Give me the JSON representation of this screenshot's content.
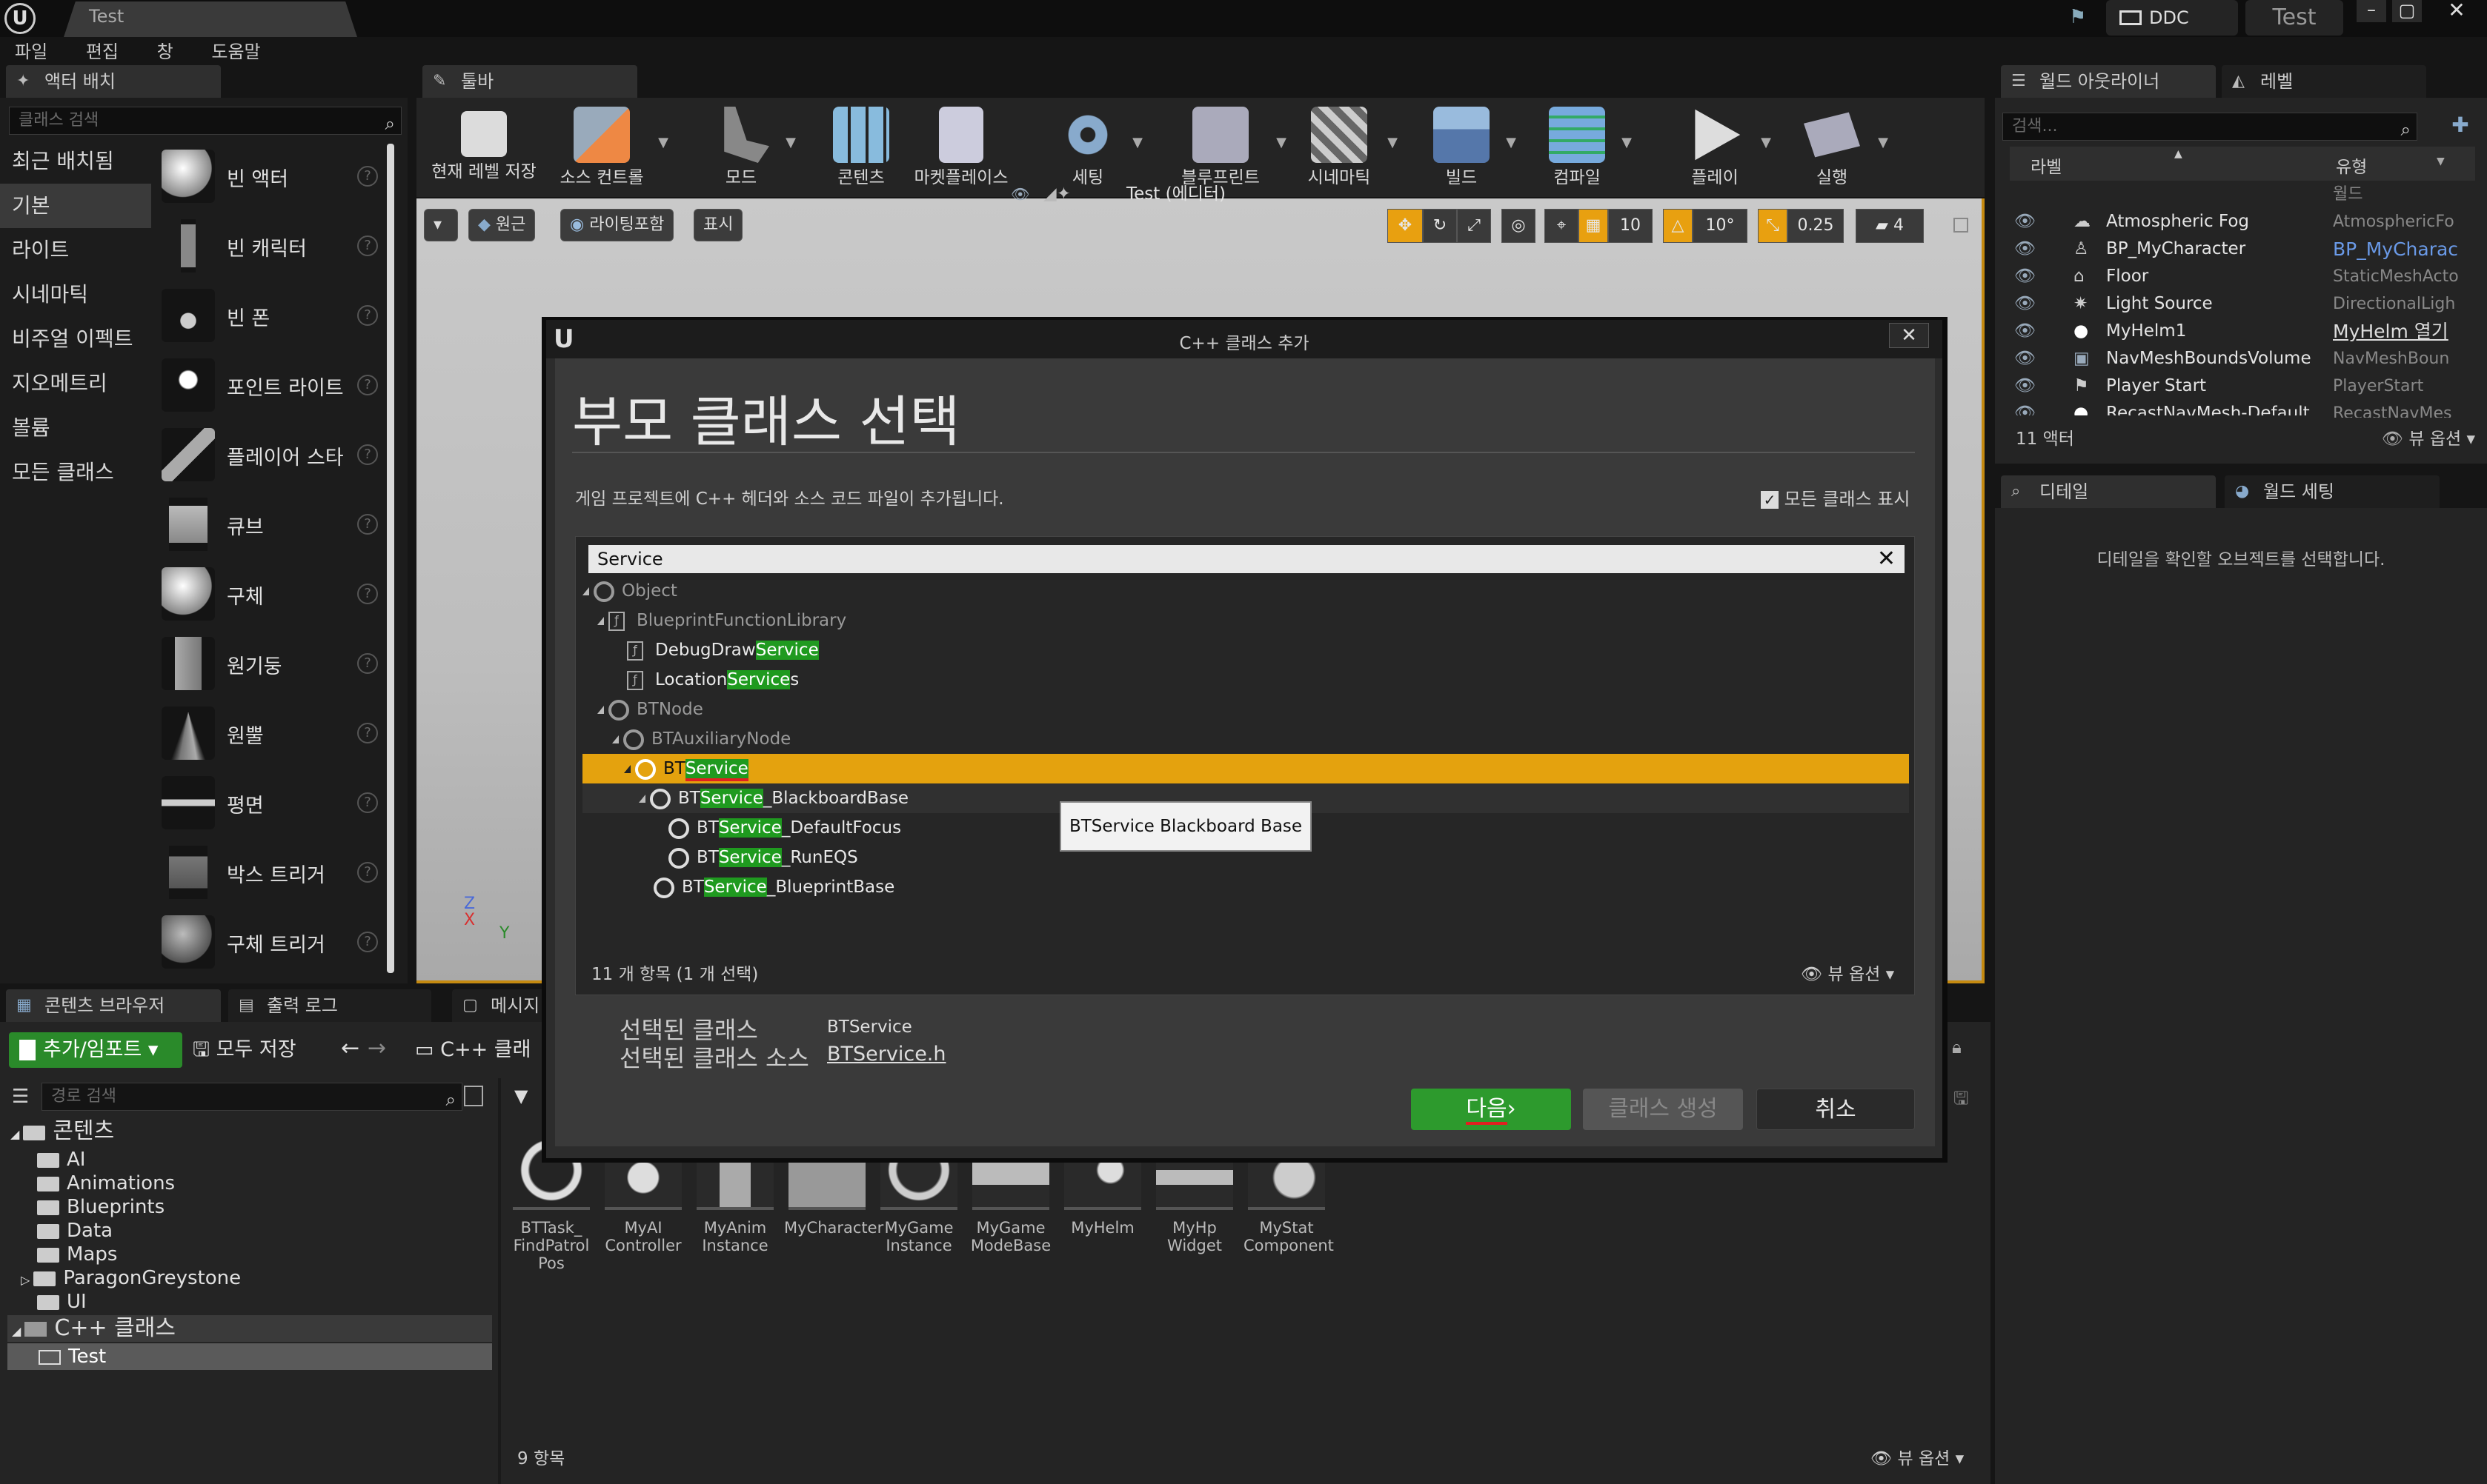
{
  "window": {
    "tab": "Test",
    "ddc": "DDC",
    "test_btn": "Test",
    "min": "–",
    "max": "▢",
    "close": "✕"
  },
  "menu": [
    "파일",
    "편집",
    "창",
    "도움말"
  ],
  "place_actors": {
    "tab": "액터 배치",
    "search_placeholder": "클래스 검색",
    "categories": [
      "최근 배치됨",
      "기본",
      "라이트",
      "시네마틱",
      "비주얼 이펙트",
      "지오메트리",
      "볼륨",
      "모든 클래스"
    ],
    "items": [
      "빈 액터",
      "빈 캐릭터",
      "빈 폰",
      "포인트 라이트",
      "플레이어 스타",
      "큐브",
      "구체",
      "원기둥",
      "원뿔",
      "평면",
      "박스 트리거",
      "구체 트리거"
    ]
  },
  "toolbar": {
    "tab": "툴바",
    "buttons": [
      "현재 레벨 저장",
      "소스 컨트롤",
      "모드",
      "콘텐츠",
      "마켓플레이스",
      "세팅",
      "블루프린트",
      "시네마틱",
      "빌드",
      "컴파일",
      "플레이",
      "실행"
    ]
  },
  "viewport": {
    "perspective": "원근",
    "lighting": "라이팅포함",
    "show": "표시",
    "grid_snap": "10",
    "rot_snap": "10°",
    "scale_snap": "0.25",
    "cam_speed": "4",
    "axis_x": "X",
    "axis_y": "Y",
    "axis_z": "Z"
  },
  "outliner": {
    "tab": "월드 아웃라이너",
    "tab2": "레벨",
    "search_placeholder": "검색...",
    "col_label": "라벨",
    "col_type": "유형",
    "rows": [
      {
        "label": "Test (에디터)",
        "type": "월드"
      },
      {
        "label": "Atmospheric Fog",
        "type": "AtmosphericFo"
      },
      {
        "label": "BP_MyCharacter",
        "type": "BP_MyCharac"
      },
      {
        "label": "Floor",
        "type": "StaticMeshActo"
      },
      {
        "label": "Light Source",
        "type": "DirectionalLigh"
      },
      {
        "label": "MyHelm1",
        "type": "MyHelm 열기"
      },
      {
        "label": "NavMeshBoundsVolume",
        "type": "NavMeshBoun"
      },
      {
        "label": "Player Start",
        "type": "PlayerStart"
      },
      {
        "label": "RecastNavMesh-Default",
        "type": "RecastNavMes"
      }
    ],
    "count": "11 액터",
    "view_options": "뷰 옵션"
  },
  "details": {
    "tab": "디테일",
    "tab2": "월드 세팅",
    "empty": "디테일을 확인할 오브젝트를 선택합니다."
  },
  "dialog": {
    "title": "C++ 클래스 추가",
    "heading": "부모 클래스 선택",
    "desc": "게임 프로젝트에 C++ 헤더와 소스 코드 파일이 추가됩니다.",
    "show_all": "모든 클래스 표시",
    "search_value": "Service",
    "tree": [
      {
        "pre": "Object",
        "hl": "",
        "post": ""
      },
      {
        "pre": "BlueprintFunctionLibrary",
        "hl": "",
        "post": ""
      },
      {
        "pre": "DebugDraw",
        "hl": "Service",
        "post": ""
      },
      {
        "pre": "Location",
        "hl": "Service",
        "post": "s"
      },
      {
        "pre": "BTNode",
        "hl": "",
        "post": ""
      },
      {
        "pre": "BTAuxiliaryNode",
        "hl": "",
        "post": ""
      },
      {
        "pre": "BT",
        "hl": "Service",
        "post": ""
      },
      {
        "pre": "BT",
        "hl": "Service",
        "post": "_BlackboardBase"
      },
      {
        "pre": "BT",
        "hl": "Service",
        "post": "_DefaultFocus"
      },
      {
        "pre": "BT",
        "hl": "Service",
        "post": "_RunEQS"
      },
      {
        "pre": "BT",
        "hl": "Service",
        "post": "_BlueprintBase"
      }
    ],
    "tooltip": "BTService Blackboard Base",
    "count": "11 개 항목 (1 개 선택)",
    "view_options": "뷰 옵션",
    "selected_class_label": "선택된 클래스",
    "selected_class": "BTService",
    "selected_source_label": "선택된 클래스 소스",
    "selected_source": "BTService.h",
    "next": "다음",
    "create": "클래스 생성",
    "cancel": "취소"
  },
  "content_browser": {
    "tab": "콘텐츠 브라우저",
    "tab2": "출력 로그",
    "tab3": "메시지",
    "add_import": "추가/임포트",
    "save_all": "모두 저장",
    "path": "C++ 클래",
    "path_search": "경로 검색",
    "folders": [
      "콘텐츠",
      "AI",
      "Animations",
      "Blueprints",
      "Data",
      "Maps",
      "ParagonGreystone",
      "UI"
    ],
    "cpp": "C++ 클래스",
    "cpp_child": "Test",
    "assets": [
      "BTTask_\nFindPatrol\nPos",
      "MyAI\nController",
      "MyAnim\nInstance",
      "MyCharacter",
      "MyGame\nInstance",
      "MyGame\nModeBase",
      "MyHelm",
      "MyHp\nWidget",
      "MyStat\nComponent"
    ],
    "count": "9 항목",
    "view_options": "뷰 옵션"
  }
}
